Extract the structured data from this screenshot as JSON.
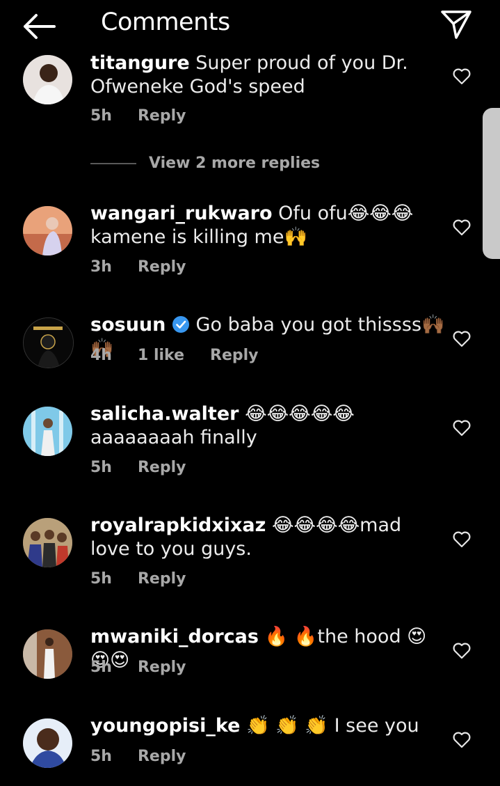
{
  "header": {
    "title": "Comments"
  },
  "replies_toggle": "View 2 more replies",
  "comments": [
    {
      "username": "titangure",
      "text": "Super proud of you Dr. Ofweneke God's speed",
      "time": "5h",
      "likes": "",
      "reply": "Reply"
    },
    {
      "username": "wangari_rukwaro",
      "text": "Ofu ofu😂😂😂 kamene is killing me🙌",
      "time": "3h",
      "likes": "",
      "reply": "Reply"
    },
    {
      "username": "sosuun",
      "text": "Go baba you got thissss🙌🏾🙌🏾",
      "time": "4h",
      "likes": "1 like",
      "reply": "Reply",
      "verified": true
    },
    {
      "username": "salicha.walter",
      "text": "😂😂😂😂😂 aaaaaaaah finally",
      "time": "5h",
      "likes": "",
      "reply": "Reply"
    },
    {
      "username": "royalrapkidxixaz",
      "text": "😂😂😂😂mad love to you guys.",
      "time": "5h",
      "likes": "",
      "reply": "Reply"
    },
    {
      "username": "mwaniki_dorcas",
      "text": "🔥 🔥the hood 😍😍😍",
      "time": "5h",
      "likes": "",
      "reply": "Reply"
    },
    {
      "username": "youngopisi_ke",
      "text": "👏 👏 👏 I see you",
      "time": "5h",
      "likes": "",
      "reply": "Reply"
    }
  ],
  "colors": {
    "background": "#000000",
    "meta": "#a8a8a8",
    "verified": "#3897f0"
  }
}
